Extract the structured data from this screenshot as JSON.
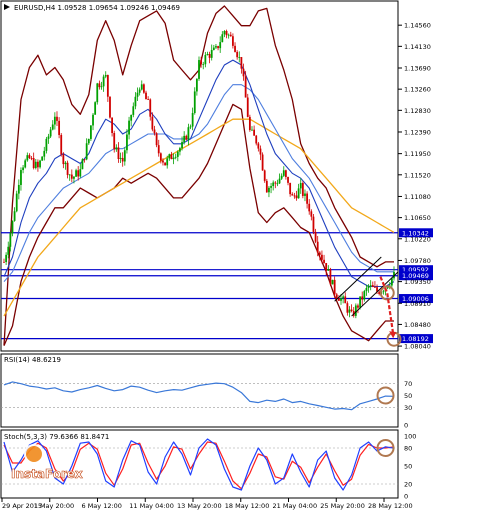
{
  "header": {
    "symbol_line": "EURUSD,H4  1.09528 1.09654 1.09246 1.09469"
  },
  "colors": {
    "candle_up": "#00a000",
    "candle_down": "#d00000",
    "bollinger": "#7a0000",
    "ma_fast": "#1f3fbf",
    "ma_mid": "#4f7fdf",
    "ma_slow": "#f2a81a",
    "hline": "#0000cc",
    "price_tag_bg": "#0000cc",
    "annotation": "#b07850",
    "arrow": "#e02020",
    "rsi_line": "#3a78d8",
    "stoch_main": "#2040ff",
    "stoch_signal": "#ff2020"
  },
  "chart_data": [
    {
      "type": "candlestick",
      "title": "EURUSD,H4",
      "ohlc_header": {
        "open": 1.09528,
        "high": 1.09654,
        "low": 1.09246,
        "close": 1.09469
      },
      "y_ticks": [
        "1.14560",
        "1.14130",
        "1.13690",
        "1.13260",
        "1.12830",
        "1.12390",
        "1.11950",
        "1.11520",
        "1.11080",
        "1.10650",
        "1.10220",
        "1.09780",
        "1.09350",
        "1.08910",
        "1.08480",
        "1.08040"
      ],
      "ylim": [
        1.0794,
        1.1497
      ],
      "x_ticks": [
        "29 Apr 2015",
        "1 May 20:00",
        "6 May 12:00",
        "11 May 04:00",
        "13 May 20:00",
        "18 May 12:00",
        "21 May 04:00",
        "25 May 20:00",
        "28 May 12:00"
      ],
      "horizontal_levels": [
        {
          "value": 1.10342,
          "label": "1.10342"
        },
        {
          "value": 1.09592,
          "label": "1.09592"
        },
        {
          "value": 1.09469,
          "label": "1.09469"
        },
        {
          "value": 1.09006,
          "label": "1.09006"
        },
        {
          "value": 1.08192,
          "label": "1.08192"
        }
      ],
      "price_anchors": [
        1.0975,
        1.1055,
        1.117,
        1.1185,
        1.1165,
        1.1215,
        1.1275,
        1.118,
        1.1145,
        1.116,
        1.1225,
        1.1335,
        1.135,
        1.1205,
        1.118,
        1.1275,
        1.1335,
        1.1295,
        1.1205,
        1.1175,
        1.1195,
        1.121,
        1.1255,
        1.1375,
        1.1395,
        1.1405,
        1.1445,
        1.1425,
        1.1375,
        1.124,
        1.1215,
        1.1125,
        1.1135,
        1.1155,
        1.1105,
        1.1125,
        1.1085,
        1.1005,
        1.0965,
        1.0915,
        1.0895,
        1.0865,
        1.0895,
        1.0925,
        1.0915,
        1.0925,
        1.0947
      ],
      "series": [
        {
          "name": "Bollinger upper",
          "values": [
            1.0805,
            1.1095,
            1.1305,
            1.137,
            1.1395,
            1.1355,
            1.137,
            1.1345,
            1.1295,
            1.1275,
            1.1315,
            1.1425,
            1.1465,
            1.1425,
            1.1355,
            1.1415,
            1.1465,
            1.1475,
            1.1485,
            1.146,
            1.1385,
            1.1365,
            1.1345,
            1.1365,
            1.144,
            1.148,
            1.1495,
            1.1475,
            1.1455,
            1.1455,
            1.1485,
            1.149,
            1.1415,
            1.1365,
            1.1305,
            1.1215,
            1.1175,
            1.1145,
            1.1125,
            1.1085,
            1.1055,
            1.1025,
            1.0985,
            1.0975,
            1.0965,
            1.0975,
            1.0975
          ]
        },
        {
          "name": "Bollinger lower",
          "values": [
            1.0805,
            1.0845,
            1.0935,
            1.0985,
            1.1025,
            1.1055,
            1.1085,
            1.1085,
            1.1105,
            1.1125,
            1.1115,
            1.1105,
            1.1115,
            1.1125,
            1.1145,
            1.1135,
            1.1145,
            1.1155,
            1.1145,
            1.1125,
            1.1105,
            1.1105,
            1.1125,
            1.1145,
            1.1175,
            1.1215,
            1.1255,
            1.1295,
            1.1285,
            1.1165,
            1.1075,
            1.1055,
            1.1075,
            1.1085,
            1.1065,
            1.1045,
            1.1035,
            1.0995,
            1.0955,
            1.0905,
            1.0865,
            1.0835,
            1.0825,
            1.0815,
            1.0835,
            1.0855,
            1.0855
          ]
        },
        {
          "name": "MA fast",
          "values": [
            1.0945,
            1.0985,
            1.1055,
            1.1105,
            1.1135,
            1.1155,
            1.1185,
            1.1195,
            1.1185,
            1.1175,
            1.1195,
            1.1235,
            1.1265,
            1.1255,
            1.1235,
            1.1245,
            1.1275,
            1.1285,
            1.1265,
            1.1235,
            1.1215,
            1.1215,
            1.1225,
            1.1265,
            1.1305,
            1.1345,
            1.1375,
            1.1385,
            1.1375,
            1.1335,
            1.1285,
            1.1235,
            1.1195,
            1.1175,
            1.1155,
            1.1145,
            1.1125,
            1.1085,
            1.1045,
            1.1005,
            1.0975,
            1.0945,
            1.0935,
            1.0925,
            1.0925,
            1.0925,
            1.0935
          ]
        },
        {
          "name": "MA mid",
          "values": [
            1.0935,
            1.0955,
            1.0995,
            1.1035,
            1.1065,
            1.1085,
            1.1105,
            1.1125,
            1.1135,
            1.1145,
            1.1155,
            1.1175,
            1.1195,
            1.1205,
            1.1205,
            1.1215,
            1.1225,
            1.1235,
            1.1235,
            1.1235,
            1.1225,
            1.1225,
            1.1225,
            1.1235,
            1.1255,
            1.1285,
            1.1315,
            1.1335,
            1.1335,
            1.1325,
            1.1305,
            1.1275,
            1.1245,
            1.1215,
            1.1185,
            1.1165,
            1.1145,
            1.1115,
            1.1085,
            1.1055,
            1.1025,
            1.0995,
            1.0975,
            1.0965,
            1.0955,
            1.0955,
            1.0955
          ]
        },
        {
          "name": "MA slow",
          "values": [
            1.0865,
            1.0895,
            1.0925,
            1.0955,
            1.0985,
            1.1005,
            1.1025,
            1.1045,
            1.1065,
            1.1085,
            1.1095,
            1.1105,
            1.1115,
            1.1125,
            1.1135,
            1.1145,
            1.1155,
            1.1165,
            1.1175,
            1.1185,
            1.1195,
            1.1205,
            1.1215,
            1.1225,
            1.1235,
            1.1245,
            1.1255,
            1.1265,
            1.1265,
            1.1265,
            1.1255,
            1.1245,
            1.1235,
            1.1225,
            1.1215,
            1.1205,
            1.1185,
            1.1165,
            1.1145,
            1.1125,
            1.1105,
            1.1085,
            1.1075,
            1.1065,
            1.1055,
            1.1045,
            1.1035
          ]
        }
      ],
      "trendlines": [
        {
          "points": [
            [
              39.0,
              1.0895
            ],
            [
              44.5,
              1.0985
            ]
          ]
        },
        {
          "points": [
            [
              41.0,
              1.0865
            ],
            [
              46.5,
              1.0955
            ]
          ]
        }
      ],
      "annotations": [
        {
          "type": "circle",
          "x": 45.2,
          "y": 1.0912
        },
        {
          "type": "circle",
          "x": 46.0,
          "y": 1.0818
        },
        {
          "type": "arrow",
          "from": [
            44.4,
            1.0945
          ],
          "mid": [
            45.2,
            1.0912
          ],
          "to": [
            45.9,
            1.0828
          ]
        }
      ]
    },
    {
      "type": "line",
      "title": "RSI(14) 48.6219",
      "ylim": [
        0,
        100
      ],
      "y_ticks": [
        "70",
        "50",
        "30",
        "0"
      ],
      "series": [
        {
          "name": "RSI(14)",
          "values": [
            68,
            73,
            70,
            66,
            64,
            61,
            63,
            58,
            56,
            60,
            63,
            67,
            62,
            58,
            60,
            66,
            64,
            59,
            55,
            58,
            60,
            59,
            63,
            67,
            69,
            71,
            70,
            64,
            55,
            40,
            38,
            42,
            40,
            44,
            38,
            40,
            36,
            33,
            30,
            27,
            28,
            26,
            36,
            40,
            44,
            49,
            48.6
          ]
        }
      ],
      "annotations": [
        {
          "type": "circle",
          "x": 45.0,
          "y": 50
        }
      ]
    },
    {
      "type": "line",
      "title": "Stoch(5,3,3) 79.6366 81.8471",
      "ylim": [
        0,
        100
      ],
      "y_ticks": [
        "100",
        "80",
        "50",
        "20",
        "0"
      ],
      "series": [
        {
          "name": "Stoch main",
          "values": [
            90,
            40,
            60,
            85,
            92,
            75,
            30,
            20,
            50,
            88,
            90,
            70,
            25,
            15,
            60,
            92,
            85,
            40,
            20,
            65,
            90,
            70,
            35,
            80,
            95,
            85,
            45,
            15,
            10,
            50,
            80,
            60,
            20,
            30,
            70,
            40,
            15,
            60,
            75,
            30,
            10,
            35,
            80,
            90,
            75,
            82,
            79.6
          ]
        },
        {
          "name": "Stoch signal",
          "values": [
            85,
            55,
            55,
            75,
            88,
            80,
            45,
            25,
            40,
            78,
            88,
            78,
            38,
            18,
            45,
            85,
            88,
            55,
            28,
            50,
            82,
            78,
            45,
            70,
            90,
            88,
            58,
            25,
            12,
            38,
            70,
            65,
            32,
            28,
            58,
            48,
            22,
            48,
            70,
            42,
            18,
            28,
            68,
            86,
            80,
            80,
            81.8
          ]
        }
      ],
      "annotations": [
        {
          "type": "circle",
          "x": 45.0,
          "y": 80
        }
      ]
    }
  ],
  "watermark": {
    "brand": "InstaForex"
  }
}
